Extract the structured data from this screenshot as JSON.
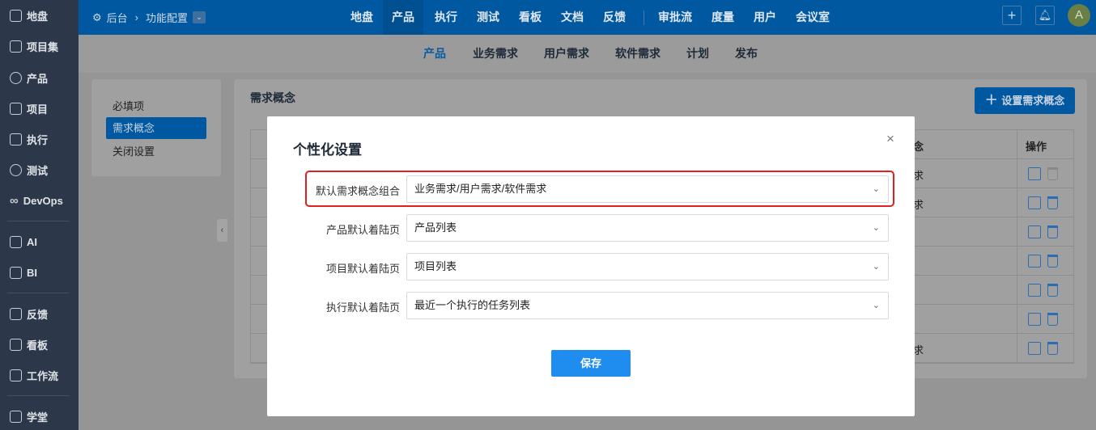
{
  "sidebar": {
    "items": [
      {
        "label": "地盘",
        "icon": "home-icon"
      },
      {
        "label": "项目集",
        "icon": "grid-icon"
      },
      {
        "label": "产品",
        "icon": "lightbulb-icon"
      },
      {
        "label": "项目",
        "icon": "rocket-icon"
      },
      {
        "label": "执行",
        "icon": "run-icon"
      },
      {
        "label": "测试",
        "icon": "search-bug-icon"
      },
      {
        "label": "DevOps",
        "icon": "infinity-icon"
      },
      {
        "label": "AI",
        "icon": "robot-icon"
      },
      {
        "label": "BI",
        "icon": "chart-board-icon"
      },
      {
        "label": "反馈",
        "icon": "feedback-icon"
      },
      {
        "label": "看板",
        "icon": "kanban-icon"
      },
      {
        "label": "工作流",
        "icon": "workflow-icon"
      },
      {
        "label": "学堂",
        "icon": "school-icon"
      }
    ]
  },
  "header": {
    "breadcrumb": {
      "root": "后台",
      "current": "功能配置"
    },
    "nav": [
      "地盘",
      "产品",
      "执行",
      "测试",
      "看板",
      "文档",
      "反馈",
      "审批流",
      "度量",
      "用户",
      "会议室"
    ],
    "active_nav": "产品",
    "avatar": "A"
  },
  "subnav": {
    "items": [
      "产品",
      "业务需求",
      "用户需求",
      "软件需求",
      "计划",
      "发布"
    ],
    "active": "产品"
  },
  "left_menu": {
    "items": [
      "必填项",
      "需求概念",
      "关闭设置"
    ],
    "active": "需求概念"
  },
  "main": {
    "title": "需求概念",
    "add_button": "设置需求概念",
    "table": {
      "header_fragment": "念",
      "actions_header": "操作",
      "row_fragments": [
        "求",
        "求",
        "",
        "",
        "",
        "",
        "求"
      ]
    }
  },
  "modal": {
    "title": "个性化设置",
    "fields": [
      {
        "label": "默认需求概念组合",
        "value": "业务需求/用户需求/软件需求"
      },
      {
        "label": "产品默认着陆页",
        "value": "产品列表"
      },
      {
        "label": "项目默认着陆页",
        "value": "项目列表"
      },
      {
        "label": "执行默认着陆页",
        "value": "最近一个执行的任务列表"
      }
    ],
    "save": "保存"
  },
  "colors": {
    "header": "#0058a0",
    "highlight": "#e02020",
    "save": "#1f8cf0"
  }
}
